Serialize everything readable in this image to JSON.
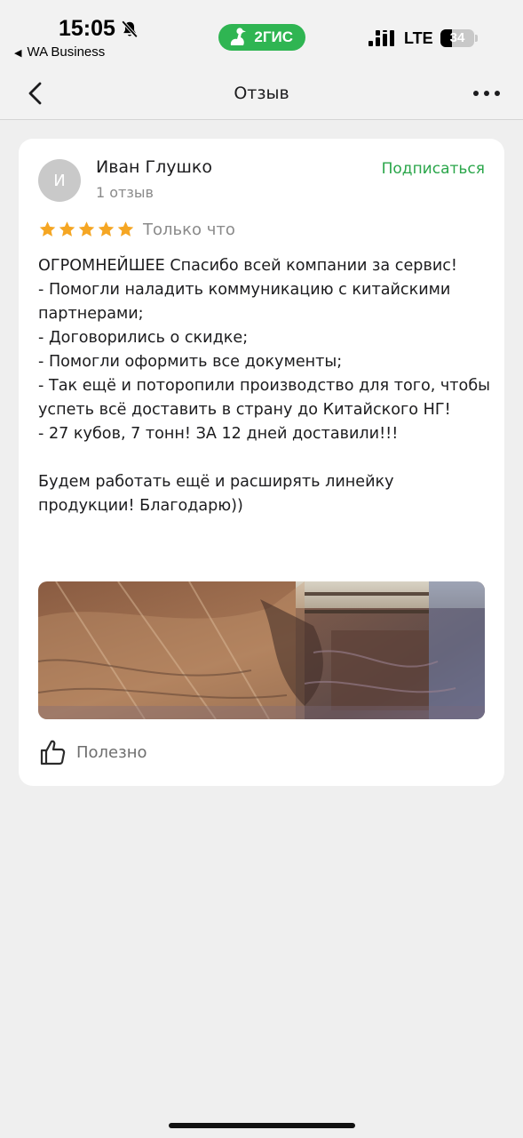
{
  "status_bar": {
    "time": "15:05",
    "back_to_app": "WA Business",
    "app_badge": "2ГИС",
    "network": "LTE",
    "battery_percent": "34",
    "battery_level": 0.34,
    "icons": [
      "bell-slash-icon",
      "signal-icon",
      "battery-icon"
    ]
  },
  "nav": {
    "title": "Отзыв",
    "icons": [
      "chevron-left-icon",
      "more-icon"
    ]
  },
  "review": {
    "avatar_initial": "И",
    "author": "Иван Глушко",
    "author_reviews": "1 отзыв",
    "subscribe_label": "Подписаться",
    "rating": 5,
    "rating_max": 5,
    "posted": "Только что",
    "text": "ОГРОМНЕЙШЕЕ Спасибо всей компании за сервис!\n- Помогли наладить коммуникацию с китайскими партнерами;\n- Договорились о скидке;\n- Помогли оформить все документы;\n- Так ещё и поторопили производство для того, чтобы успеть всё доставить в страну до Китайского НГ!\n- 27 кубов, 7 тонн! ЗА 12 дней доставили!!!\n\nБудем работать ещё и расширять линейку продукции! Благодарю))",
    "helpful_label": "Полезно"
  },
  "colors": {
    "accent": "#2aa64a",
    "badge": "#2fb552",
    "star": "#f5a623",
    "background": "#efefef"
  }
}
